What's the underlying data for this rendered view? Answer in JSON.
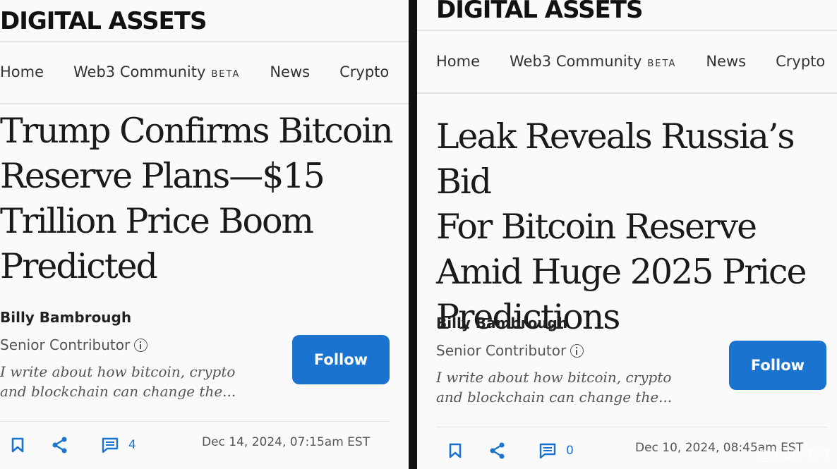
{
  "left": {
    "brand": "DIGITAL ASSETS",
    "nav": [
      {
        "label": "Home",
        "badge": ""
      },
      {
        "label": "Web3 Community",
        "badge": "BETA"
      },
      {
        "label": "News",
        "badge": ""
      },
      {
        "label": "Crypto",
        "badge": ""
      }
    ],
    "headline_lines": [
      "Trump Confirms Bitcoin",
      "Reserve Plans—$15",
      "Trillion Price Boom",
      "Predicted"
    ],
    "author": "Billy Bambrough",
    "role": "Senior Contributor",
    "bio_lines": [
      "I write about how bitcoin, crypto",
      "and blockchain can change the..."
    ],
    "follow_label": "Follow",
    "comment_count": "4",
    "date": "Dec 14, 2024, 07:15am EST"
  },
  "right": {
    "brand": "DIGITAL ASSETS",
    "nav": [
      {
        "label": "Home",
        "badge": ""
      },
      {
        "label": "Web3 Community",
        "badge": "BETA"
      },
      {
        "label": "News",
        "badge": ""
      },
      {
        "label": "Crypto",
        "badge": ""
      }
    ],
    "headline_lines": [
      "Leak Reveals Russia’s Bid",
      "For Bitcoin Reserve",
      "Amid Huge 2025 Price",
      "Predictions"
    ],
    "author": "Billy Bambrough",
    "role": "Senior Contributor",
    "bio_lines": [
      "I write about how bitcoin, crypto",
      "and blockchain can change the..."
    ],
    "follow_label": "Follow",
    "comment_count": "0",
    "date": "Dec 10, 2024, 08:45am EST"
  },
  "watermark": "@lindy777",
  "colors": {
    "accent": "#1a73cf",
    "text": "#1a1a1a",
    "background": "#fafafa"
  },
  "icons": [
    "bookmark-icon",
    "share-icon",
    "comment-icon",
    "info-icon"
  ]
}
